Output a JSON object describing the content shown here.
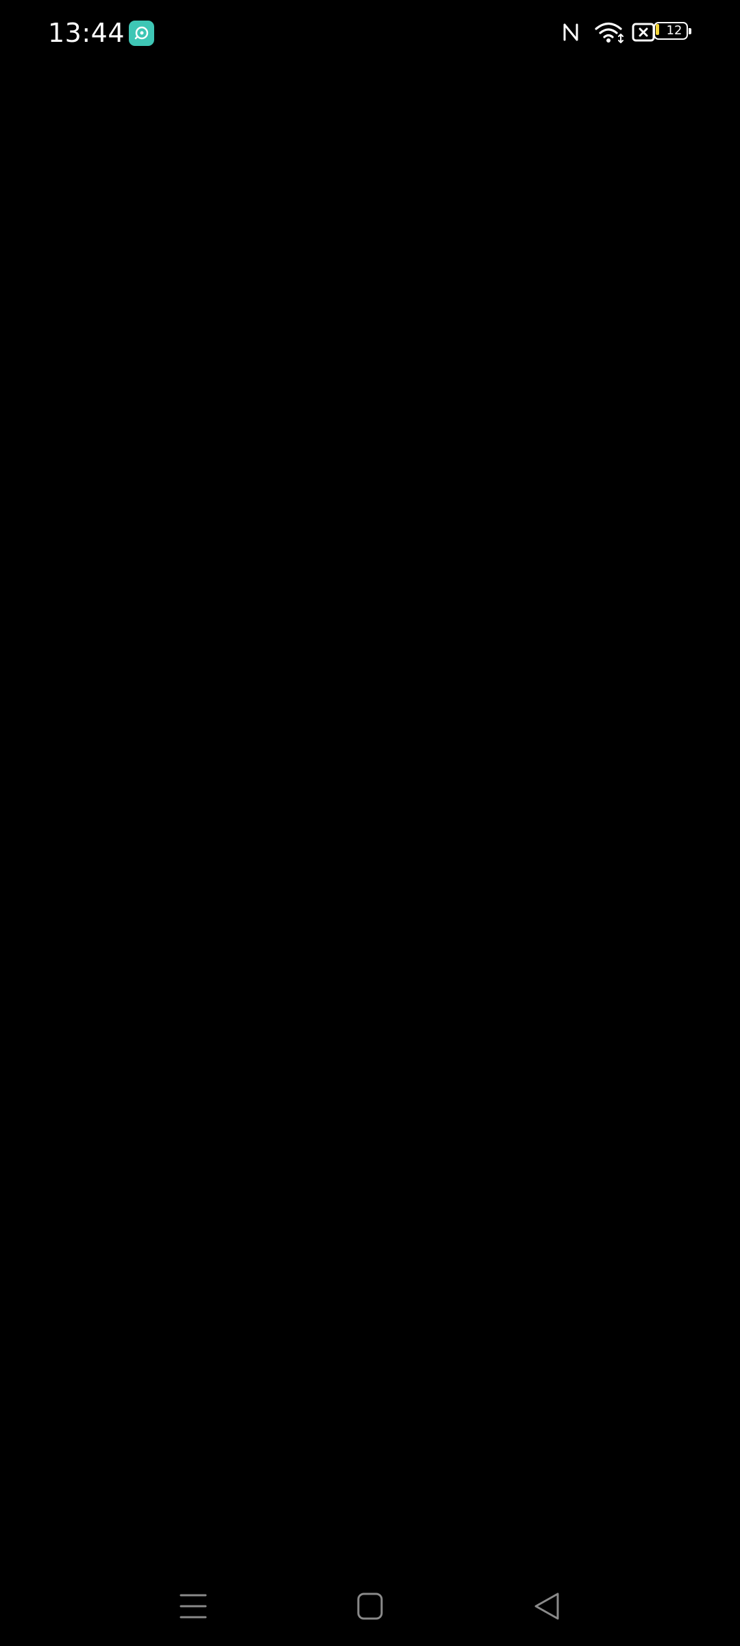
{
  "status_bar": {
    "time": "13:44",
    "battery_level": "12",
    "battery_fraction": 0.12,
    "icons": [
      "app-notification-icon",
      "nfc-icon",
      "wifi-icon",
      "sim-disabled-icon",
      "battery-icon"
    ]
  },
  "colors": {
    "background": "#000000",
    "app_notification": "#3ec6b5",
    "battery_fill": "#f2d43a",
    "nav_icons": "#8a8a8a"
  },
  "nav_bar": {
    "buttons": [
      "menu-icon",
      "home-icon",
      "back-icon"
    ]
  }
}
